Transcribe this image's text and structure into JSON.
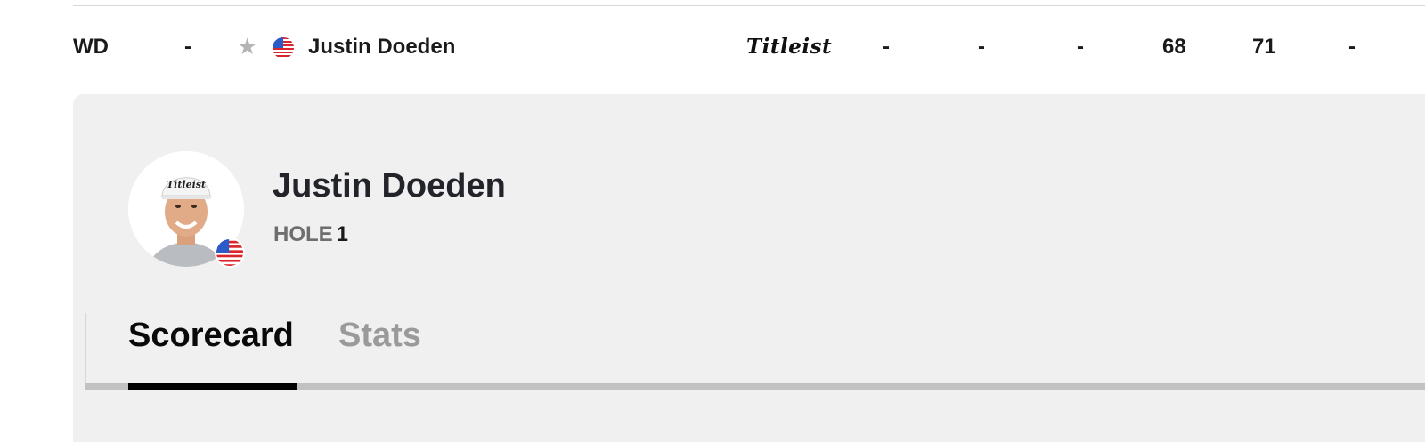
{
  "leaderboard_row": {
    "position": "WD",
    "movement": "-",
    "player_name": "Justin Doeden",
    "country": "USA",
    "sponsor": "Titleist",
    "col1": "-",
    "col2": "-",
    "col3": "-",
    "col4": "68",
    "col5": "71",
    "col6": "-"
  },
  "icons": {
    "favorite": "star-icon",
    "flag": "us-flag-icon"
  },
  "player_panel": {
    "name": "Justin Doeden",
    "hole_label": "HOLE",
    "hole_value": "1"
  },
  "tabs": [
    {
      "label": "Scorecard",
      "active": true
    },
    {
      "label": "Stats",
      "active": false
    }
  ],
  "colors": {
    "panel_bg": "#f0f0f0",
    "active_tab": "#0a0a0a",
    "inactive_tab": "#9a9a9a",
    "star": "#b4b4b4"
  }
}
